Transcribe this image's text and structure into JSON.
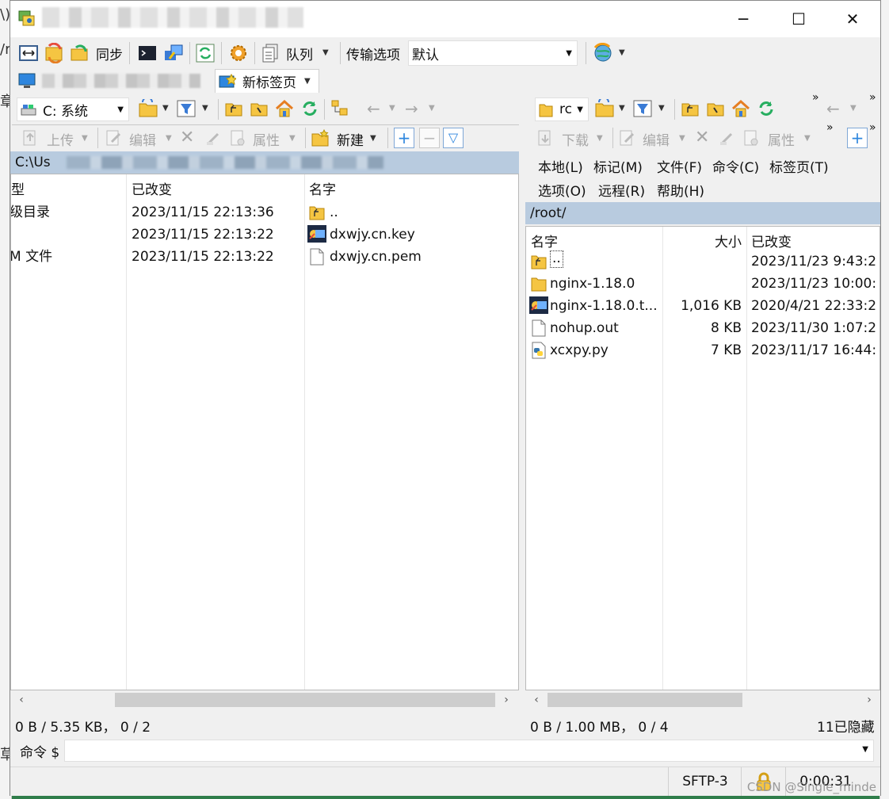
{
  "window": {
    "minimize_glyph": "─",
    "maximize_glyph": "☐",
    "close_glyph": "✕"
  },
  "toolbar1": {
    "sync_label": "同步",
    "queue_label": "队列",
    "transfer_options_label": "传输选项",
    "transfer_preset_value": "默认"
  },
  "tabs": {
    "new_tab_label": "新标签页"
  },
  "left": {
    "drive_label": "C: 系统",
    "actions": {
      "upload": "上传",
      "edit": "编辑",
      "properties": "属性",
      "new": "新建"
    },
    "path": "C:\\Us",
    "columns": {
      "type": "型",
      "modified": "已改变",
      "name": "名字"
    },
    "files": [
      {
        "type": "级目录",
        "modified": "2023/11/15 22:13:36",
        "name": "..",
        "icon": "parent-folder"
      },
      {
        "type": "",
        "modified": "2023/11/15 22:13:22",
        "name": "dxwjy.cn.key",
        "icon": "key-file"
      },
      {
        "type": "M 文件",
        "modified": "2023/11/15 22:13:22",
        "name": "dxwjy.cn.pem",
        "icon": "document"
      }
    ],
    "status": "0 B / 5.35 KB，   0 / 2"
  },
  "right": {
    "dir_label": "rc",
    "actions": {
      "download": "下载",
      "edit": "编辑",
      "properties": "属性"
    },
    "menu": [
      "本地(L)",
      "标记(M)",
      "文件(F)",
      "命令(C)",
      "标签页(T)",
      "选项(O)",
      "远程(R)",
      "帮助(H)"
    ],
    "path": "/root/",
    "columns": {
      "name": "名字",
      "size": "大小",
      "modified": "已改变"
    },
    "files": [
      {
        "name": "..",
        "size": "",
        "modified": "2023/11/23 9:43:2",
        "icon": "parent-folder"
      },
      {
        "name": "nginx-1.18.0",
        "size": "",
        "modified": "2023/11/23 10:00:",
        "icon": "folder"
      },
      {
        "name": "nginx-1.18.0.t...",
        "size": "1,016 KB",
        "modified": "2020/4/21 22:33:2",
        "icon": "archive"
      },
      {
        "name": "nohup.out",
        "size": "8 KB",
        "modified": "2023/11/30 1:07:2",
        "icon": "document"
      },
      {
        "name": "xcxpy.py",
        "size": "7 KB",
        "modified": "2023/11/17 16:44:",
        "icon": "python-file"
      }
    ],
    "status": "0 B / 1.00 MB，   0 / 4",
    "hidden_count": "11已隐藏"
  },
  "command": {
    "label": "命令 $",
    "value": ""
  },
  "statusbar": {
    "protocol": "SFTP-3",
    "elapsed": "0:00:31"
  },
  "watermark": "CSDN @Single_minde",
  "bg": {
    "chars": [
      "\\)、",
      "/r",
      "章",
      "草"
    ]
  }
}
